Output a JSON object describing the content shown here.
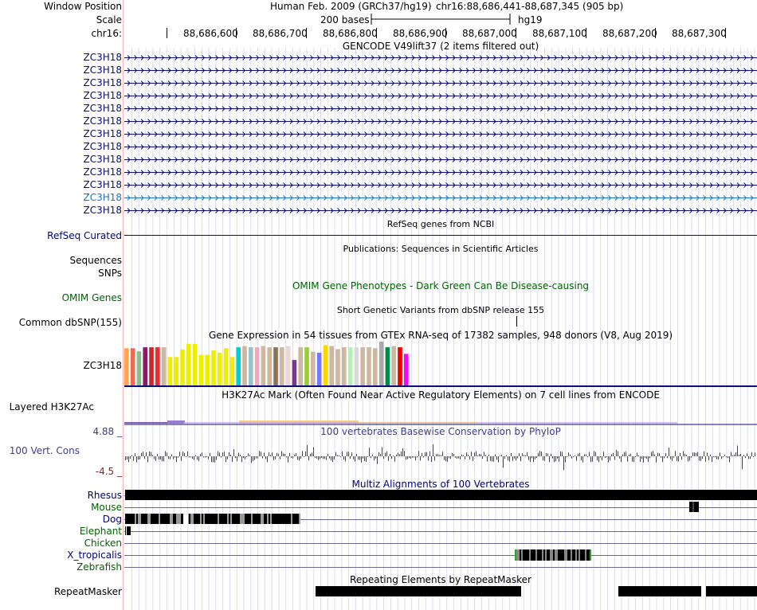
{
  "header": {
    "window_position_label": "Window Position",
    "scale_label": "Scale",
    "chrom_label": "chr16:",
    "assembly": "Human Feb. 2009 (GRCh37/hg19)",
    "position": "chr16:88,686,441-88,687,345 (905 bp)",
    "scale_text": "200 bases",
    "db": "hg19",
    "ticks": [
      "88,686,600",
      "88,686,700",
      "88,686,800",
      "88,686,900",
      "88,687,000",
      "88,687,100",
      "88,687,200",
      "88,687,300"
    ]
  },
  "gencode": {
    "title": "GENCODE V49lift37 (2 items filtered out)",
    "items": [
      "ZC3H18",
      "ZC3H18",
      "ZC3H18",
      "ZC3H18",
      "ZC3H18",
      "ZC3H18",
      "ZC3H18",
      "ZC3H18",
      "ZC3H18",
      "ZC3H18",
      "ZC3H18",
      "ZC3H18",
      "ZC3H18"
    ],
    "highlight_index": 11,
    "color": "#0c0c78",
    "highlight_color": "#1e73be"
  },
  "refseq": {
    "title": "RefSeq genes from NCBI",
    "label": "RefSeq Curated"
  },
  "publications": {
    "title": "Publications: Sequences in Scientific Articles",
    "label1": "Sequences",
    "label2": "SNPs"
  },
  "omim": {
    "title": "OMIM Gene Phenotypes - Dark Green Can Be Disease-causing",
    "label": "OMIM Genes",
    "color": "#006400"
  },
  "dbsnp": {
    "title": "Short Genetic Variants from dbSNP release 155",
    "label": "Common dbSNP(155)"
  },
  "gtex": {
    "title": "Gene Expression in 54 tissues from GTEx RNA-seq of 17382 samples, 948 donors (V8, Aug 2019)",
    "label": "ZC3H18",
    "bars": [
      {
        "c": "#ffa54f",
        "v": 0.85
      },
      {
        "c": "#ee6a50",
        "v": 0.85
      },
      {
        "c": "#8fbc8f",
        "v": 0.78
      },
      {
        "c": "#8b1c62",
        "v": 0.87
      },
      {
        "c": "#cd2626",
        "v": 0.87
      },
      {
        "c": "#ee2c2c",
        "v": 0.87
      },
      {
        "c": "#cdb79e",
        "v": 0.87
      },
      {
        "c": "#eeee00",
        "v": 0.65
      },
      {
        "c": "#eeee00",
        "v": 0.65
      },
      {
        "c": "#eeee00",
        "v": 0.82
      },
      {
        "c": "#eeee00",
        "v": 0.95
      },
      {
        "c": "#eeee00",
        "v": 0.95
      },
      {
        "c": "#eeee00",
        "v": 0.7
      },
      {
        "c": "#eeee00",
        "v": 0.7
      },
      {
        "c": "#eeee00",
        "v": 0.8
      },
      {
        "c": "#eeee00",
        "v": 0.75
      },
      {
        "c": "#eeee00",
        "v": 0.85
      },
      {
        "c": "#eeee00",
        "v": 0.65
      },
      {
        "c": "#00ced1",
        "v": 0.87
      },
      {
        "c": "#cdb79e",
        "v": 0.9
      },
      {
        "c": "#9ac0cd",
        "v": 0.87
      },
      {
        "c": "#eea9b8",
        "v": 0.87
      },
      {
        "c": "#cdb79e",
        "v": 0.9
      },
      {
        "c": "#cdb79e",
        "v": 0.87
      },
      {
        "c": "#8b7355",
        "v": 0.87
      },
      {
        "c": "#cdb79e",
        "v": 0.87
      },
      {
        "c": "#eed5d2",
        "v": 0.9
      },
      {
        "c": "#7a378b",
        "v": 0.58
      },
      {
        "c": "#cdb79e",
        "v": 0.87
      },
      {
        "c": "#9acd32",
        "v": 0.87
      },
      {
        "c": "#cdb79e",
        "v": 0.77
      },
      {
        "c": "#7777ff",
        "v": 0.75
      },
      {
        "c": "#ffd700",
        "v": 0.92
      },
      {
        "c": "#cdb79e",
        "v": 0.9
      },
      {
        "c": "#cdb79e",
        "v": 0.83
      },
      {
        "c": "#cdb79e",
        "v": 0.87
      },
      {
        "c": "#b4eeb4",
        "v": 0.87
      },
      {
        "c": "#d9d9d9",
        "v": 0.87
      },
      {
        "c": "#cdb79e",
        "v": 0.87
      },
      {
        "c": "#cdb79e",
        "v": 0.87
      },
      {
        "c": "#cdb79e",
        "v": 0.85
      },
      {
        "c": "#aaaaaa",
        "v": 1.0
      },
      {
        "c": "#008b45",
        "v": 0.87
      },
      {
        "c": "#cdb79e",
        "v": 0.9
      },
      {
        "c": "#ee0000",
        "v": 0.87
      },
      {
        "c": "#ff00ff",
        "v": 0.72
      }
    ]
  },
  "h3k27ac": {
    "title": "H3K27Ac Mark (Often Found Near Active Regulatory Elements) on 7 cell lines from ENCODE",
    "label": "Layered H3K27Ac"
  },
  "phylop": {
    "title": "100 vertebrates Basewise Conservation by PhyloP",
    "label": "100 Vert. Cons",
    "max_label": "4.88 _",
    "min_label": "-4.5 _"
  },
  "multiz": {
    "title": "Multiz Alignments of 100 Vertebrates",
    "species": [
      {
        "name": "Rhesus",
        "color": "#000080"
      },
      {
        "name": "Mouse",
        "color": "#006400"
      },
      {
        "name": "Dog",
        "color": "#000080"
      },
      {
        "name": "Elephant",
        "color": "#006400"
      },
      {
        "name": "Chicken",
        "color": "#006400"
      },
      {
        "name": "X_tropicalis",
        "color": "#000080"
      },
      {
        "name": "Zebrafish",
        "color": "#006400"
      }
    ]
  },
  "repeatmasker": {
    "title": "Repeating Elements by RepeatMasker",
    "label": "RepeatMasker"
  }
}
